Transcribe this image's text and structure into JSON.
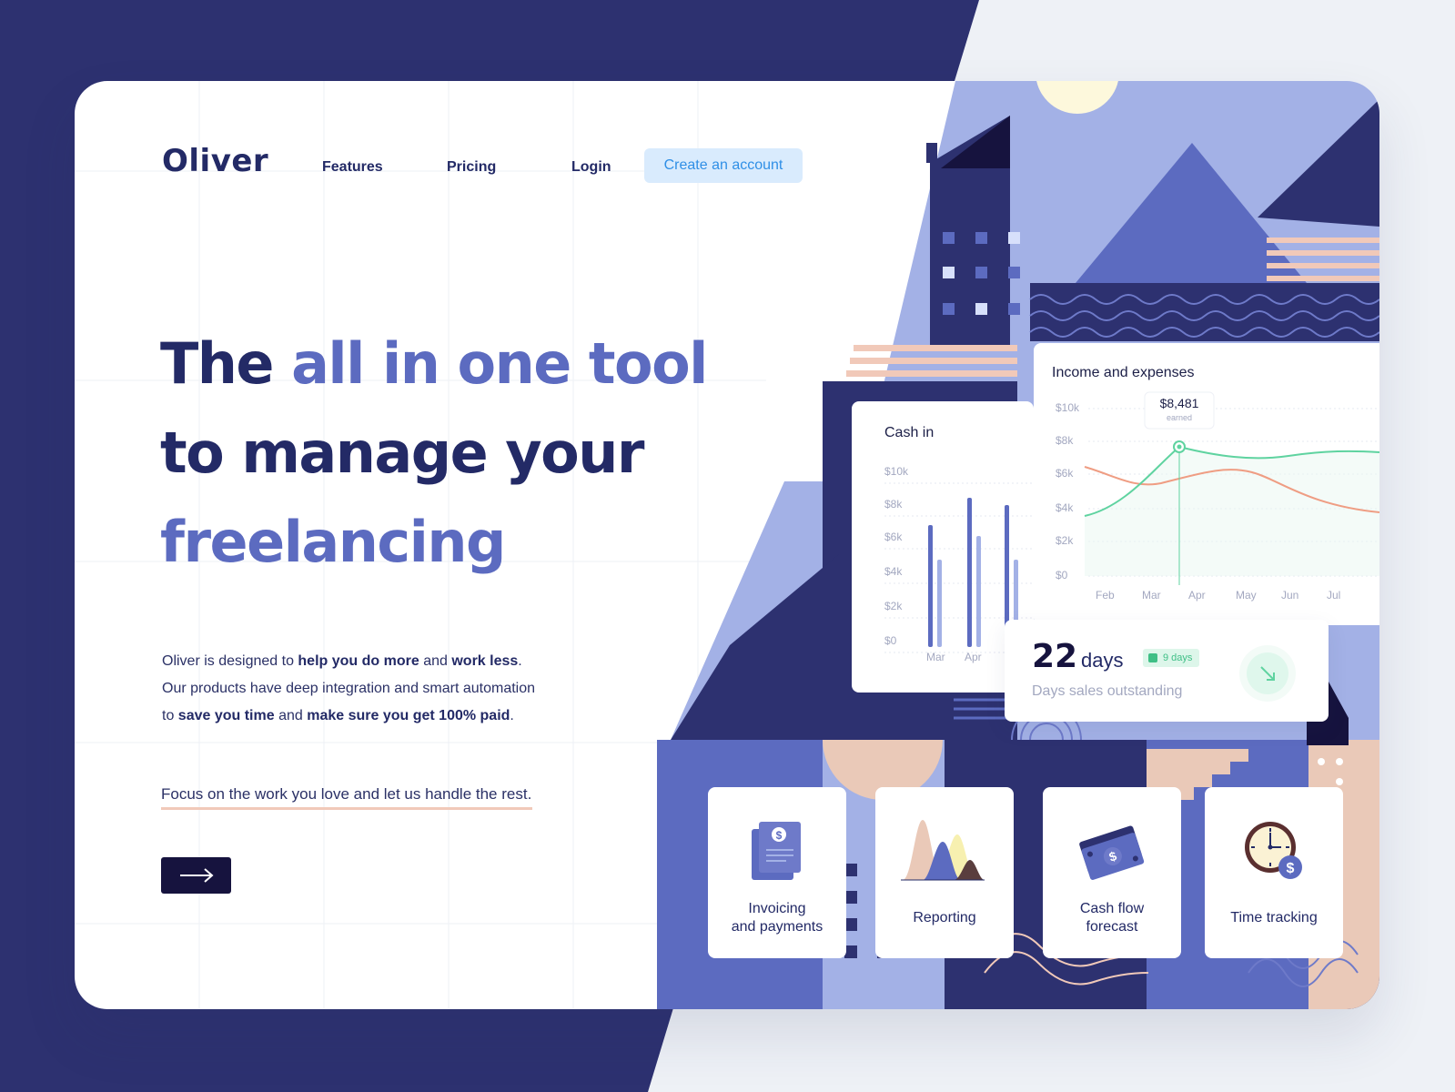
{
  "brand": {
    "name": "Oliver"
  },
  "nav": {
    "features": "Features",
    "pricing": "Pricing",
    "login": "Login",
    "cta": "Create an account"
  },
  "hero": {
    "line1_a": "The ",
    "line1_b": "all in one tool",
    "line2": "to manage your",
    "line3": "freelancing",
    "p1_a": "Oliver is designed to ",
    "p1_b": "help you do more",
    "p1_c": " and ",
    "p1_d": "work less",
    "p1_e": ".",
    "p2": "Our products have deep integration and smart automation",
    "p3_a": "to ",
    "p3_b": "save you time",
    "p3_c": " and ",
    "p3_d": "make sure you get 100% paid",
    "p3_e": ".",
    "focus": "Focus on the work you love and let us handle the rest.",
    "arrow_icon": "arrow-right-icon"
  },
  "cash_in": {
    "title": "Cash in",
    "y_ticks": [
      "$10k",
      "$8k",
      "$6k",
      "$4k",
      "$2k",
      "$0"
    ],
    "months": [
      "Mar",
      "Apr"
    ],
    "colors": {
      "primary": "#5c6bc0",
      "secondary": "#a3b1e6"
    }
  },
  "income": {
    "title": "Income and expenses",
    "y_ticks": [
      "$10k",
      "$8k",
      "$6k",
      "$4k",
      "$2k",
      "$0"
    ],
    "months": [
      "Feb",
      "Mar",
      "Apr",
      "May",
      "Jun",
      "Jul"
    ],
    "tooltip_value": "$8,481",
    "tooltip_label": "earned",
    "colors": {
      "income": "#5fd3a0",
      "expenses": "#ef9d83"
    }
  },
  "dso": {
    "number": "22",
    "unit": "days",
    "badge": "9 days",
    "label": "Days sales outstanding",
    "icon": "arrow-down-right-icon"
  },
  "features": [
    {
      "label_1": "Invoicing",
      "label_2": "and payments",
      "icon": "invoice-icon"
    },
    {
      "label_1": "Reporting",
      "label_2": "",
      "icon": "reporting-chart-icon"
    },
    {
      "label_1": "Cash flow",
      "label_2": "forecast",
      "icon": "cash-icon"
    },
    {
      "label_1": "Time tracking",
      "label_2": "",
      "icon": "clock-dollar-icon"
    }
  ],
  "colors": {
    "navy": "#2d3170",
    "ink": "#232a66",
    "accent": "#5c6bc0",
    "cta_bg": "#d9ebfd",
    "cta_text": "#2f8fe6"
  }
}
